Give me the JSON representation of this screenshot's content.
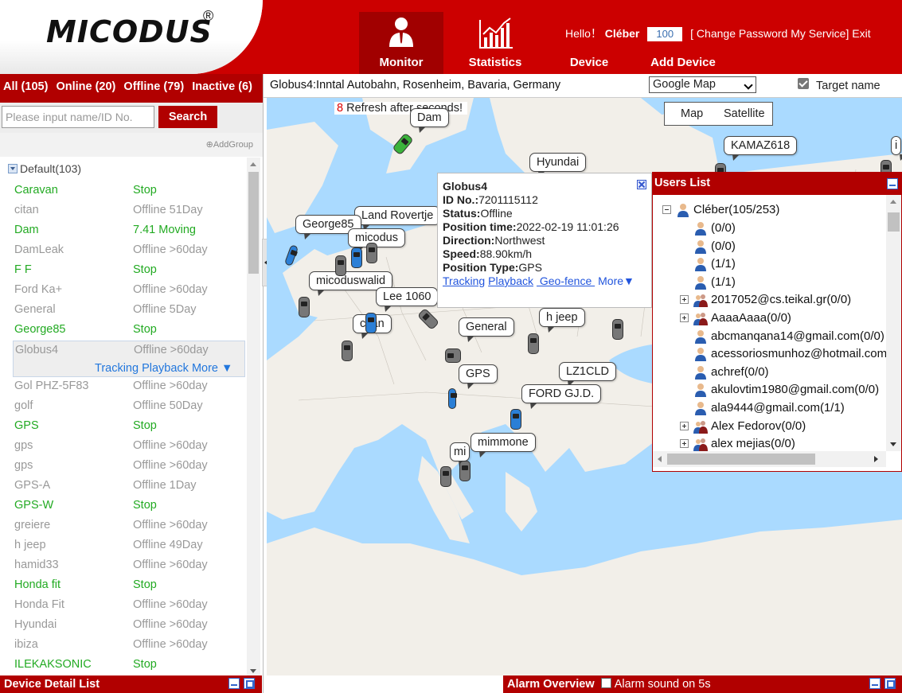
{
  "header": {
    "logo": "MICODUS",
    "logo_mark": "®",
    "nav": [
      {
        "label": "Monitor",
        "icon": "user-monitor-icon"
      },
      {
        "label": "Statistics",
        "icon": "bar-chart-icon"
      },
      {
        "label": "Device",
        "icon": "device-icon"
      },
      {
        "label": "Add Device",
        "icon": "add-device-icon"
      }
    ],
    "hello": "Hello！",
    "user": "Cléber",
    "count": "100",
    "change_password": "[ Change Password",
    "my_service": "My Service]",
    "exit": "Exit"
  },
  "left": {
    "filters": {
      "all": "All (105)",
      "online": "Online (20)",
      "offline": "Offline (79)",
      "inactive": "Inactive (6)"
    },
    "search_placeholder": "Please input name/ID No.",
    "search_label": "Search",
    "add_group": "AddGroup",
    "group": "Default(103)",
    "selected_links": "Tracking Playback More ▼",
    "devices": [
      {
        "name": "Caravan",
        "status": "Stop",
        "online": true
      },
      {
        "name": "citan",
        "status": "Offline 51Day",
        "online": false
      },
      {
        "name": "Dam",
        "status": "7.41  Moving",
        "online": true
      },
      {
        "name": "DamLeak",
        "status": "Offline >60day",
        "online": false
      },
      {
        "name": "F F",
        "status": "Stop",
        "online": true
      },
      {
        "name": "Ford Ka+",
        "status": "Offline >60day",
        "online": false
      },
      {
        "name": "General",
        "status": "Offline 5Day",
        "online": false
      },
      {
        "name": "George85",
        "status": "Stop",
        "online": true
      },
      {
        "name": "Globus4",
        "status": "Offline >60day",
        "online": false,
        "selected": true
      },
      {
        "name": "Gol PHZ-5F83",
        "status": "Offline >60day",
        "online": false
      },
      {
        "name": "golf",
        "status": "Offline 50Day",
        "online": false
      },
      {
        "name": "GPS",
        "status": "Stop",
        "online": true
      },
      {
        "name": "gps",
        "status": "Offline >60day",
        "online": false
      },
      {
        "name": "gps",
        "status": "Offline >60day",
        "online": false
      },
      {
        "name": "GPS-A",
        "status": "Offline 1Day",
        "online": false
      },
      {
        "name": "GPS-W",
        "status": "Stop",
        "online": true
      },
      {
        "name": "greiere",
        "status": "Offline >60day",
        "online": false
      },
      {
        "name": "h jeep",
        "status": "Offline 49Day",
        "online": false
      },
      {
        "name": "hamid33",
        "status": "Offline >60day",
        "online": false
      },
      {
        "name": "Honda fit",
        "status": "Stop",
        "online": true
      },
      {
        "name": "Honda Fit",
        "status": "Offline >60day",
        "online": false
      },
      {
        "name": "Hyundai",
        "status": "Offline >60day",
        "online": false
      },
      {
        "name": "ibiza",
        "status": "Offline >60day",
        "online": false
      },
      {
        "name": "ILEKAKSONIC",
        "status": "Stop",
        "online": true
      }
    ]
  },
  "bottom": {
    "device_detail": "Device Detail List",
    "alarm_overview": "Alarm Overview",
    "alarm_sound": "Alarm sound on 5s"
  },
  "map": {
    "address": "Globus4:Inntal Autobahn, Rosenheim, Bavaria, Germany",
    "map_type": "Google Map",
    "target_name": "Target name",
    "refresh_count": "8",
    "refresh_text": "Refresh after seconds!",
    "map_btn": "Map",
    "satellite_btn": "Satellite",
    "labels": [
      "Dam",
      "Hyundai",
      "KAMAZ618",
      "Land Rovertje",
      "George85",
      "micodus",
      "micoduswalid",
      "Lee 1060",
      "citan",
      "General",
      "h jeep",
      "GPS",
      "LZ1CLD",
      "FORD GJ.D.",
      "mimmone",
      "mi",
      "i"
    ]
  },
  "popup": {
    "title": "Globus4",
    "id_label": "ID No.:",
    "id": "7201115112",
    "status_label": "Status:",
    "status": "Offline",
    "time_label": "Position time:",
    "time": "2022-02-19 11:01:26",
    "dir_label": "Direction:",
    "dir": "Northwest",
    "speed_label": "Speed:",
    "speed": "88.90km/h",
    "ptype_label": "Position Type:",
    "ptype": "GPS",
    "links": [
      "Tracking",
      "Playback",
      " Geo-fence ",
      "More▼"
    ]
  },
  "users": {
    "title": "Users List",
    "root": "Cléber(105/253)",
    "items": [
      {
        "text": "(0/0)",
        "type": "user"
      },
      {
        "text": "(0/0)",
        "type": "user"
      },
      {
        "text": "(1/1)",
        "type": "user"
      },
      {
        "text": "(1/1)",
        "type": "user"
      },
      {
        "text": "2017052@cs.teikal.gr(0/0)",
        "type": "group"
      },
      {
        "text": "AaaaAaaa(0/0)",
        "type": "group"
      },
      {
        "text": "abcmanqana14@gmail.com(0/0)",
        "type": "user"
      },
      {
        "text": "acessoriosmunhoz@hotmail.com",
        "type": "user"
      },
      {
        "text": "achref(0/0)",
        "type": "user"
      },
      {
        "text": "akulovtim1980@gmail.com(0/0)",
        "type": "user"
      },
      {
        "text": "ala9444@gmail.com(1/1)",
        "type": "user"
      },
      {
        "text": "Alex Fedorov(0/0)",
        "type": "group"
      },
      {
        "text": "alex mejias(0/0)",
        "type": "group"
      }
    ]
  }
}
